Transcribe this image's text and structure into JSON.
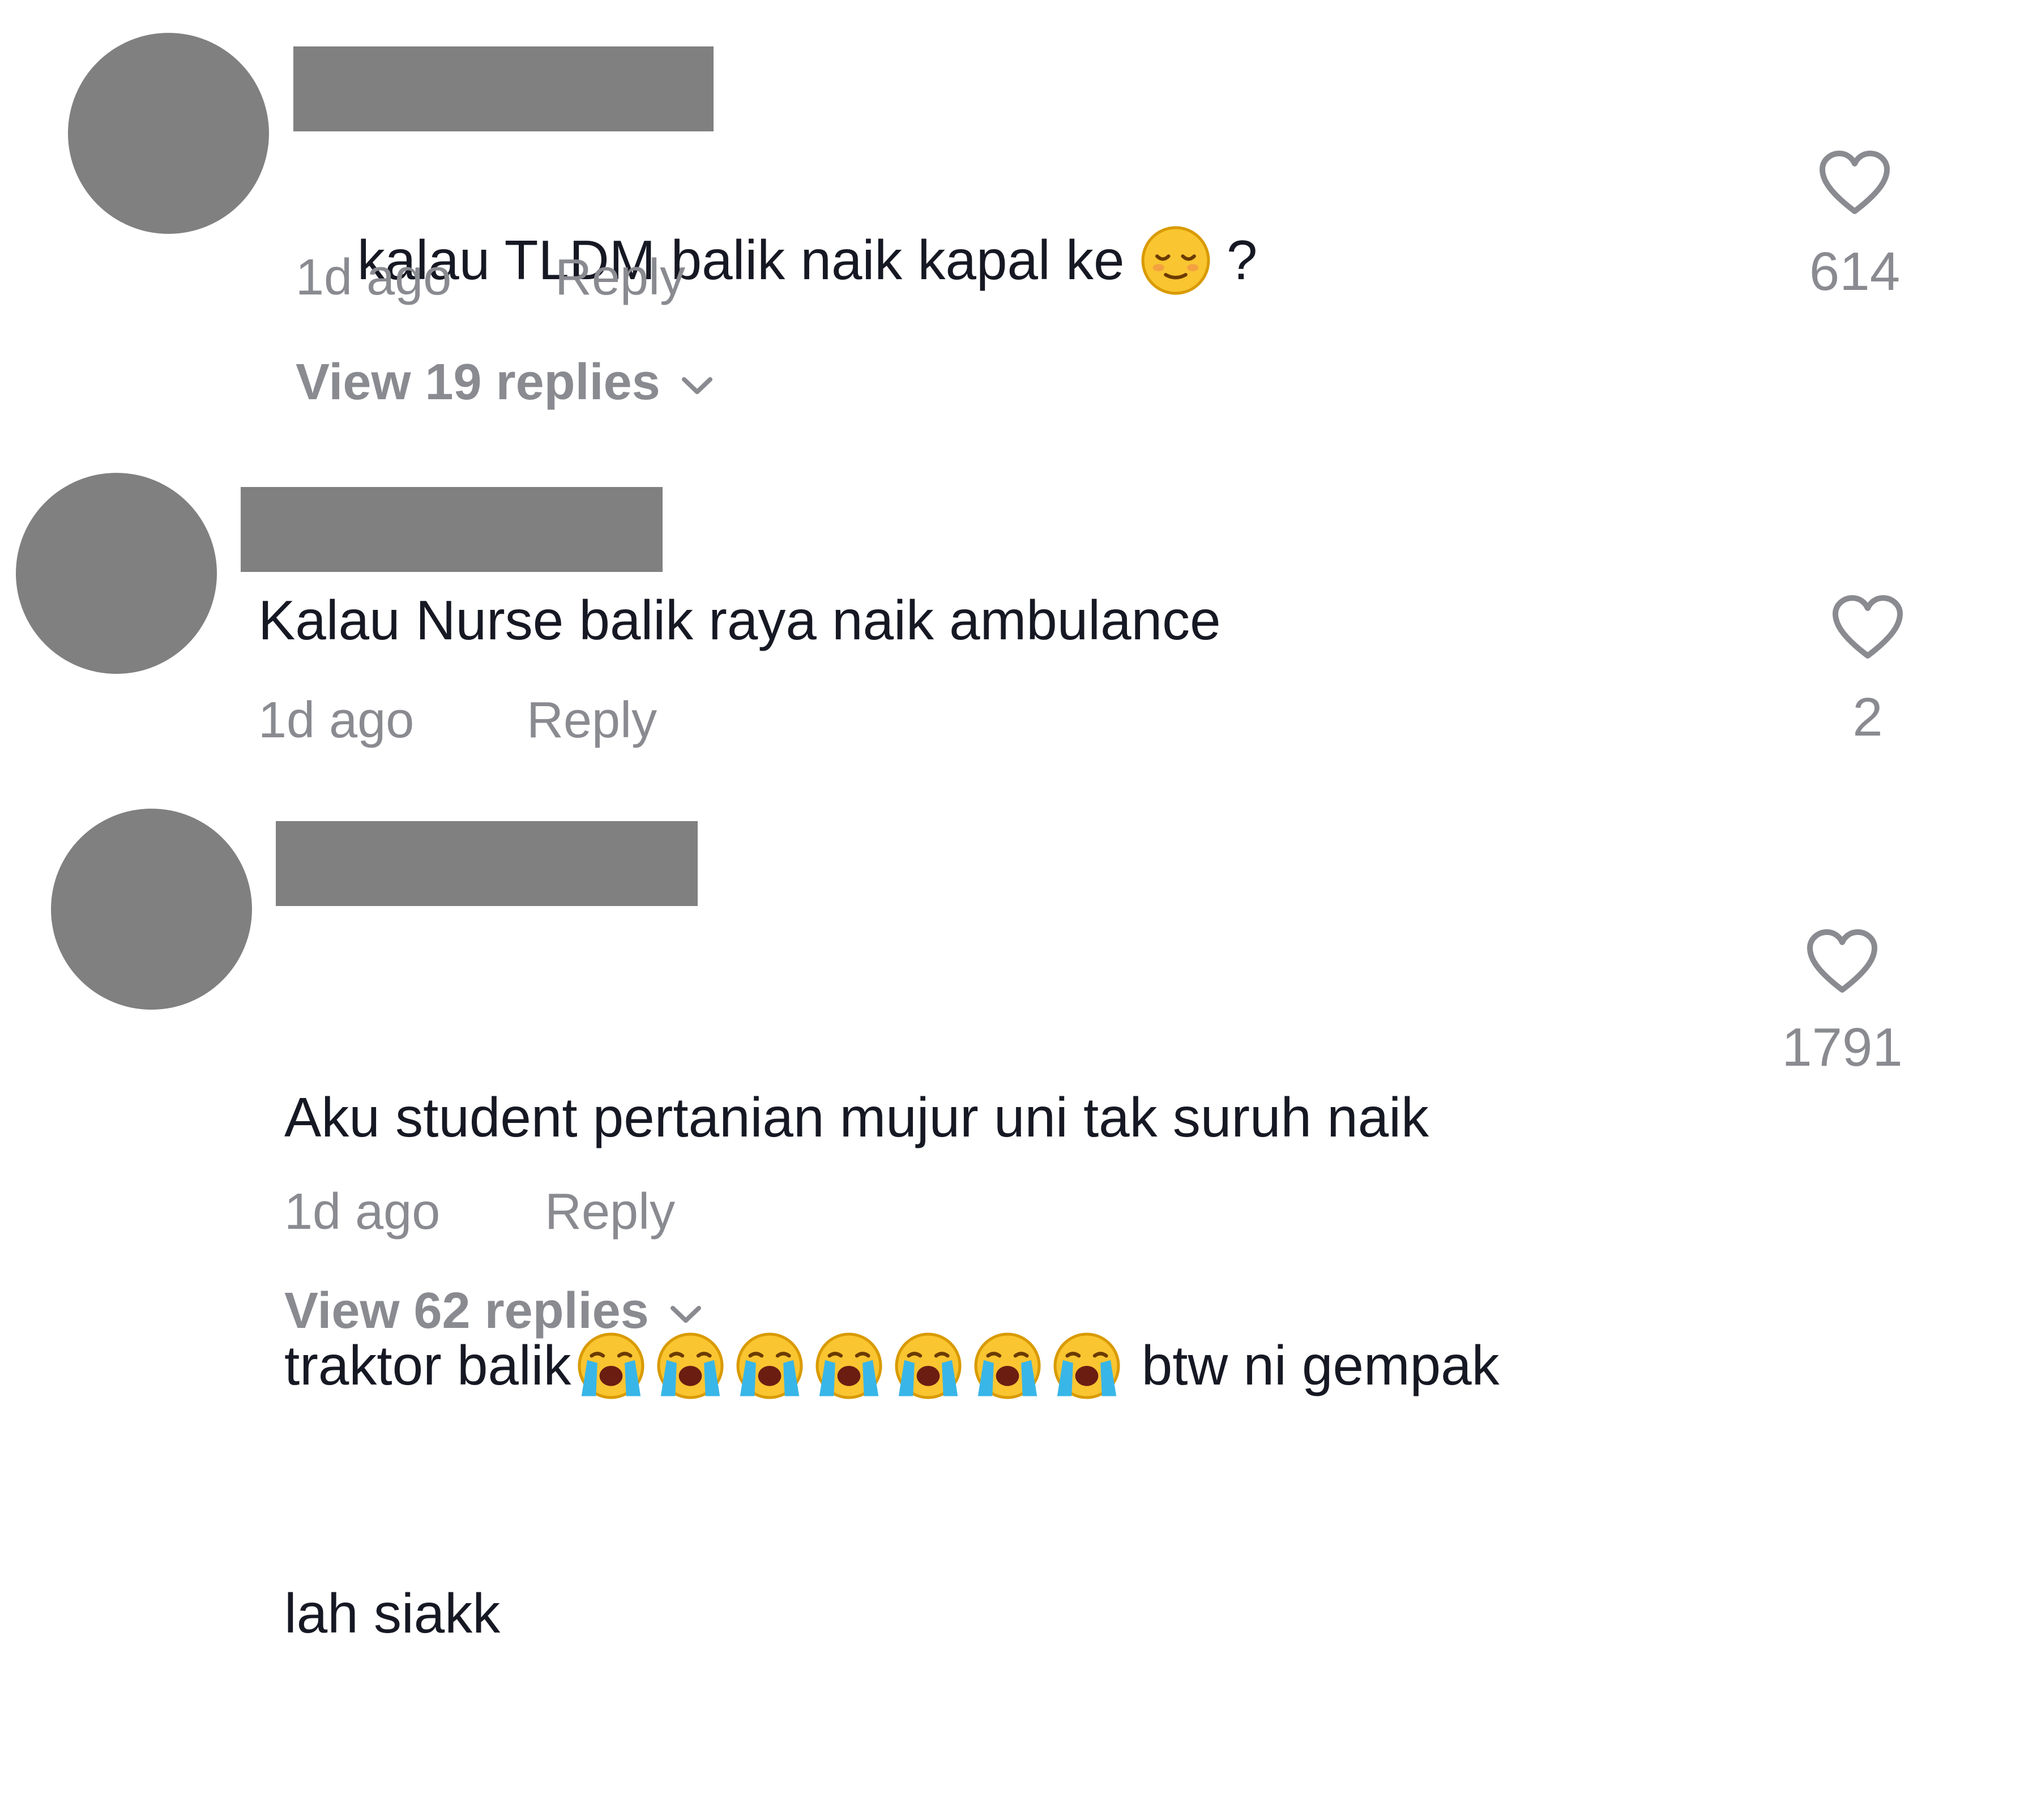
{
  "comments": [
    {
      "text_before": "kalau TLDM balik naik kapal ke ",
      "emoji_1": "relieved-face-emoji",
      "text_after": " ?",
      "time": "1d ago",
      "reply_label": "Reply",
      "likes": "614",
      "view_replies": "View 19 replies"
    },
    {
      "text": "Kalau Nurse balik raya naik ambulance",
      "time": "1d ago",
      "reply_label": "Reply",
      "likes": "2"
    },
    {
      "line1": "Aku student pertanian mujur uni tak suruh naik",
      "line2_before": "traktor balik",
      "emoji_repeat": "loudly-crying-face-emoji",
      "line2_after": " btw ni gempak",
      "line3": "lah siakk",
      "time": "1d ago",
      "reply_label": "Reply",
      "likes": "1791",
      "view_replies": "View 62 replies"
    }
  ],
  "colors": {
    "redaction": "#808080",
    "meta_text": "#8a8b91",
    "body_text": "#161823"
  }
}
